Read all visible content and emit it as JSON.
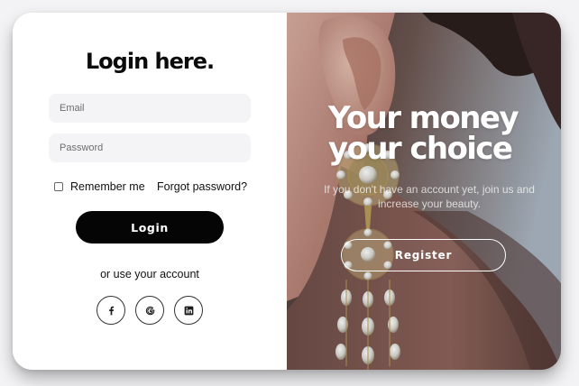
{
  "login": {
    "title": "Login here.",
    "email_placeholder": "Email",
    "password_placeholder": "Password",
    "remember_label": "Remember me",
    "remember_checked": false,
    "forgot_label": "Forgot password?",
    "login_label": "Login",
    "alt_text": "or use your account",
    "socials": [
      {
        "name": "facebook",
        "icon": "facebook-icon"
      },
      {
        "name": "google",
        "icon": "google-icon"
      },
      {
        "name": "linkedin",
        "icon": "linkedin-icon"
      }
    ]
  },
  "promo": {
    "headline_line1": "Your money",
    "headline_line2": "your choice",
    "text": "If you don't have an account yet, join us and increase your beauty.",
    "register_label": "Register",
    "image": "earring-portrait-photo"
  },
  "colors": {
    "page_background": "#f3f3f5",
    "card_background": "#ffffff",
    "input_background": "#f4f4f6",
    "primary_button": "#050505",
    "text_primary": "#111111",
    "promo_text": "#ffffff"
  }
}
